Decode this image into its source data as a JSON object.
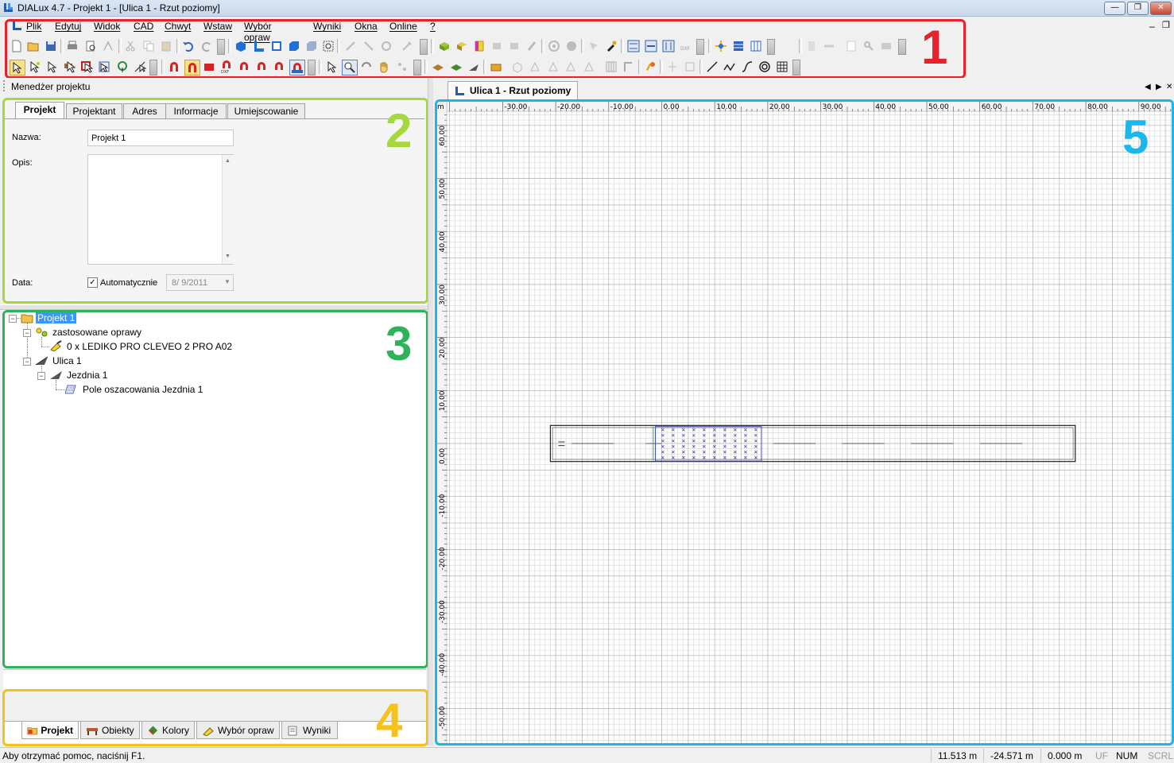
{
  "window": {
    "title": "DIALux 4.7 - Projekt 1 - [Ulica 1 - Rzut poziomy]",
    "minimize": "—",
    "restore": "❐",
    "close": "✕"
  },
  "menubar": {
    "items": [
      "Plik",
      "Edytuj",
      "Widok",
      "CAD",
      "Chwyt",
      "Wstaw",
      "Wybór opraw",
      "Wyniki",
      "Okna",
      "Online",
      "?"
    ]
  },
  "markers": {
    "m1": "1",
    "m2": "2",
    "m3": "3",
    "m4": "4",
    "m5": "5"
  },
  "colors": {
    "marker1": "#e8222a",
    "marker2": "#a6d83d",
    "marker3": "#2eb35a",
    "marker4": "#f5c21b",
    "marker5": "#1cb6ea"
  },
  "project_manager": {
    "title": "Menedżer projektu",
    "tabs": [
      "Projekt",
      "Projektant",
      "Adres",
      "Informacje",
      "Umiejscowanie"
    ],
    "active_tab": "Projekt",
    "name_label": "Nazwa:",
    "name_value": "Projekt 1",
    "desc_label": "Opis:",
    "desc_value": "",
    "date_label": "Data:",
    "auto_label": "Automatycznie",
    "auto_checked": true,
    "date_value": "8/ 9/2011"
  },
  "tree": {
    "root": "Projekt 1",
    "luminaires_group": "zastosowane oprawy",
    "luminaire": "0 x LEDIKO PRO  CLEVEO 2 PRO A02",
    "street": "Ulica 1",
    "roadway": "Jezdnia 1",
    "field": "Pole oszacowania Jezdnia 1"
  },
  "bottom_tabs": [
    "Projekt",
    "Obiekty",
    "Kolory",
    "Wybór opraw",
    "Wyniki"
  ],
  "document_tab": "Ulica 1 - Rzut poziomy",
  "ruler": {
    "unit": "m",
    "x_labels": [
      "-30.00",
      "-20.00",
      "-10.00",
      "0.00",
      "10.00",
      "20.00",
      "30.00",
      "40.00",
      "50.00",
      "60.00",
      "70.00",
      "80.00",
      "90.00"
    ],
    "y_labels": [
      "60.00",
      "50.00",
      "40.00",
      "30.00",
      "20.00",
      "10.00",
      "0.00",
      "-10.00",
      "-20.00",
      "-30.00",
      "-40.00",
      "-50.00"
    ]
  },
  "status": {
    "help": "Aby otrzymać pomoc, naciśnij F1.",
    "x": "11.513 m",
    "y": "-24.571 m",
    "z": "0.000 m",
    "uf": "UF",
    "num": "NUM",
    "scrl": "SCRL"
  }
}
